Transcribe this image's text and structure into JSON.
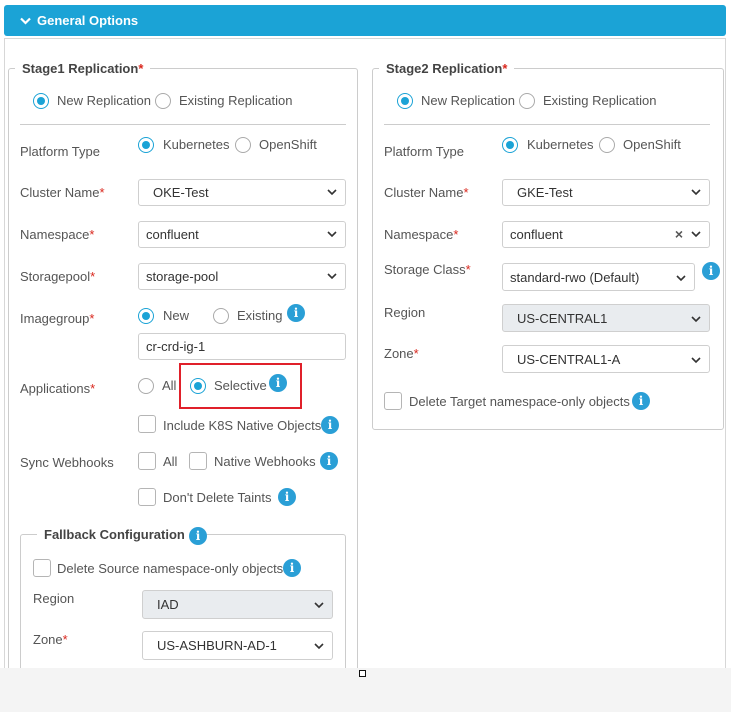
{
  "panel": {
    "title": "General Options"
  },
  "stage1": {
    "legend": "Stage1 Replication",
    "req": "*",
    "replication": {
      "new": "New Replication",
      "existing": "Existing Replication",
      "selected": "new"
    },
    "platform": {
      "label": "Platform Type",
      "kubernetes": "Kubernetes",
      "openshift": "OpenShift",
      "selected": "kubernetes"
    },
    "cluster": {
      "label": "Cluster Name",
      "value": "OKE-Test"
    },
    "namespace": {
      "label": "Namespace",
      "value": "confluent"
    },
    "storagepool": {
      "label": "Storagepool",
      "value": "storage-pool"
    },
    "imagegroup": {
      "label": "Imagegroup",
      "new": "New",
      "existing": "Existing",
      "selected": "new",
      "value": "cr-crd-ig-1"
    },
    "applications": {
      "label": "Applications",
      "all": "All",
      "selective": "Selective",
      "selected": "selective"
    },
    "include_k8s": "Include K8S Native Objects",
    "sync_webhooks": {
      "label": "Sync Webhooks",
      "all": "All",
      "native": "Native Webhooks"
    },
    "dont_delete_taints": "Don't Delete Taints",
    "fallback": {
      "legend": "Fallback Configuration",
      "delete_source": "Delete Source namespace-only objects",
      "region": {
        "label": "Region",
        "value": "IAD"
      },
      "zone": {
        "label": "Zone",
        "value": "US-ASHBURN-AD-1"
      }
    }
  },
  "stage2": {
    "legend": "Stage2 Replication",
    "req": "*",
    "replication": {
      "new": "New Replication",
      "existing": "Existing Replication",
      "selected": "new"
    },
    "platform": {
      "label": "Platform Type",
      "kubernetes": "Kubernetes",
      "openshift": "OpenShift",
      "selected": "kubernetes"
    },
    "cluster": {
      "label": "Cluster Name",
      "value": "GKE-Test"
    },
    "namespace": {
      "label": "Namespace",
      "value": "confluent",
      "clear": "×"
    },
    "storage_class": {
      "label": "Storage Class",
      "value": "standard-rwo (Default)"
    },
    "region": {
      "label": "Region",
      "value": "US-CENTRAL1"
    },
    "zone": {
      "label": "Zone",
      "value": "US-CENTRAL1-A"
    },
    "delete_target": "Delete Target namespace-only objects"
  },
  "icons": {
    "info": "i"
  },
  "colors": {
    "accent": "#1ba3d6",
    "required": "#d9261c",
    "highlight": "#e0202a",
    "disabled_bg": "#e9ecef"
  }
}
